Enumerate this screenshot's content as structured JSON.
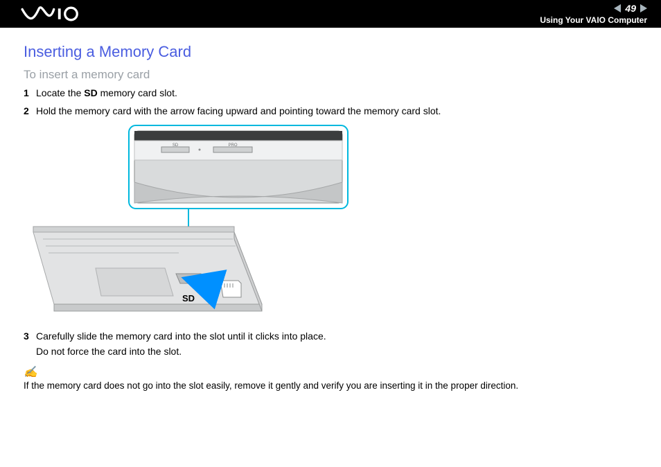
{
  "header": {
    "page_number": "49",
    "breadcrumb": "Using Your VAIO Computer"
  },
  "title": "Inserting a Memory Card",
  "subtitle": "To insert a memory card",
  "steps": [
    {
      "num": "1",
      "pre": "Locate the ",
      "bold": "SD",
      "post": " memory card slot."
    },
    {
      "num": "2",
      "pre": "Hold the memory card with the arrow facing upward and pointing toward the memory card slot.",
      "bold": "",
      "post": ""
    },
    {
      "num": "3",
      "pre": "Carefully slide the memory card into the slot until it clicks into place.",
      "bold": "",
      "post": "",
      "line2": "Do not force the card into the slot."
    }
  ],
  "figure": {
    "sd_label": "SD",
    "inset_sd": "SD",
    "inset_pro": "PRO"
  },
  "note": {
    "icon": "✍",
    "text": "If the memory card does not go into the slot easily, remove it gently and verify you are inserting it in the proper direction."
  }
}
